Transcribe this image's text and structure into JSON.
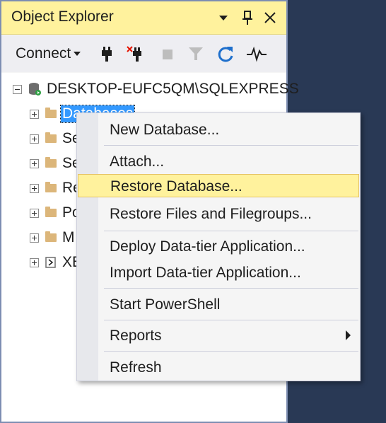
{
  "panel": {
    "title": "Object Explorer",
    "title_buttons": [
      "dropdown-arrow-icon",
      "pin-icon",
      "close-icon"
    ]
  },
  "toolbar": {
    "connect_label": "Connect",
    "icons": [
      "connect-plug-icon",
      "disconnect-icon",
      "stop-icon",
      "filter-icon",
      "refresh-icon",
      "activity-monitor-icon"
    ]
  },
  "tree": {
    "root": "DESKTOP-EUFC5QM\\SQLEXPRESS",
    "children": [
      {
        "label": "Databases",
        "icon": "folder-icon",
        "selected": true
      },
      {
        "label": "Se",
        "icon": "folder-icon"
      },
      {
        "label": "Se",
        "icon": "folder-icon"
      },
      {
        "label": "Re",
        "icon": "folder-icon"
      },
      {
        "label": "Po",
        "icon": "folder-icon"
      },
      {
        "label": "M",
        "icon": "folder-icon"
      },
      {
        "label": "XE",
        "icon": "xevent-icon"
      }
    ]
  },
  "context_menu": {
    "items": [
      {
        "label": "New Database..."
      },
      {
        "label": "Attach..."
      },
      {
        "label": "Restore Database...",
        "highlighted": true
      },
      {
        "label": "Restore Files and Filegroups..."
      },
      {
        "label": "Deploy Data-tier Application..."
      },
      {
        "label": "Import Data-tier Application..."
      },
      {
        "label": "Start PowerShell"
      },
      {
        "label": "Reports",
        "has_submenu": true
      },
      {
        "label": "Refresh"
      }
    ]
  },
  "colors": {
    "title_highlight": "#FFF29D",
    "selection": "#3399FF",
    "background": "#293955"
  }
}
